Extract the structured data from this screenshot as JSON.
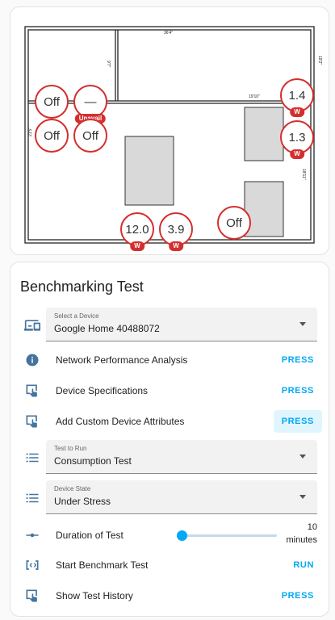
{
  "floorplan": {
    "dims": {
      "top_room_width": "36'4\"",
      "left_room_height": "9'7\"",
      "right_wall": "19'2\"",
      "room_width_mid": "19'10\"",
      "left_wall_lower": "21'5\"",
      "right_wall_lower": "18'11\""
    },
    "markers": [
      {
        "value": "Off",
        "badge": ""
      },
      {
        "value": "—",
        "badge": "Unavail"
      },
      {
        "value": "Off",
        "badge": ""
      },
      {
        "value": "Off",
        "badge": ""
      },
      {
        "value": "1.4",
        "badge": "W"
      },
      {
        "value": "1.3",
        "badge": "W"
      },
      {
        "value": "12.0",
        "badge": "W"
      },
      {
        "value": "3.9",
        "badge": "W"
      },
      {
        "value": "Off",
        "badge": ""
      }
    ]
  },
  "bench": {
    "title": "Benchmarking Test",
    "device_select": {
      "label": "Select a Device",
      "value": "Google Home 40488072"
    },
    "rows": [
      {
        "label": "Network Performance Analysis",
        "button": "PRESS"
      },
      {
        "label": "Device Specifications",
        "button": "PRESS"
      },
      {
        "label": "Add Custom Device Attributes",
        "button": "PRESS"
      }
    ],
    "test_select": {
      "label": "Test to Run",
      "value": "Consumption Test"
    },
    "state_select": {
      "label": "Device State",
      "value": "Under Stress"
    },
    "duration": {
      "label": "Duration of Test",
      "value": "10",
      "unit": "minutes",
      "fraction": 0.05
    },
    "start": {
      "label": "Start Benchmark Test",
      "button": "RUN"
    },
    "history": {
      "label": "Show Test History",
      "button": "PRESS"
    }
  },
  "colors": {
    "accent": "#03a9f4",
    "marker": "#d32f2f",
    "icon": "#44739e"
  }
}
